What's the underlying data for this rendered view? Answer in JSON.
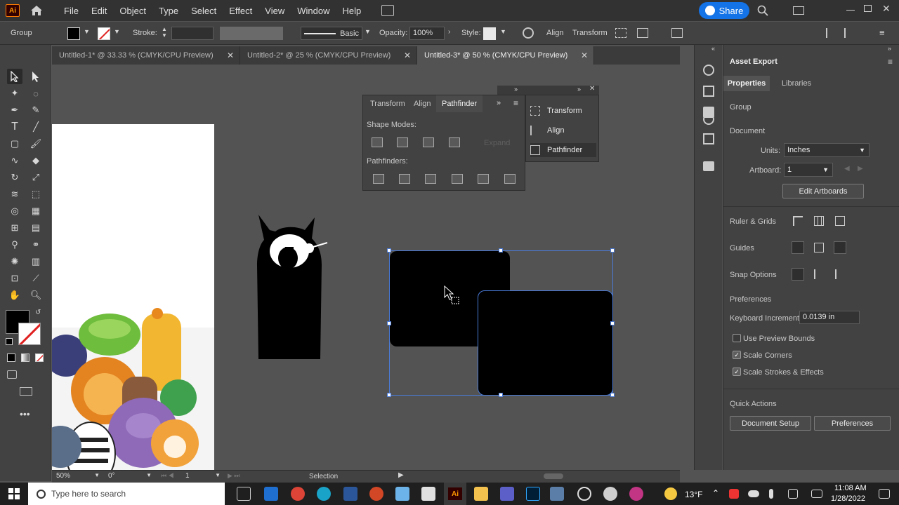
{
  "app": {
    "logo": "Ai"
  },
  "menu": [
    "File",
    "Edit",
    "Object",
    "Type",
    "Select",
    "Effect",
    "View",
    "Window",
    "Help"
  ],
  "share_label": "Share",
  "control": {
    "selection_type": "Group",
    "stroke_label": "Stroke:",
    "brush_label": "Basic",
    "opacity_label": "Opacity:",
    "opacity_value": "100%",
    "style_label": "Style:",
    "align_label": "Align",
    "transform_label": "Transform"
  },
  "tabs": [
    {
      "label": "Untitled-1* @ 33.33 % (CMYK/CPU Preview)"
    },
    {
      "label": "Untitled-2* @ 25 % (CMYK/CPU Preview)"
    },
    {
      "label": "Untitled-3* @ 50 % (CMYK/CPU Preview)"
    }
  ],
  "pathfinder_panel": {
    "tabs": [
      "Transform",
      "Align",
      "Pathfinder"
    ],
    "shape_modes_label": "Shape Modes:",
    "expand_label": "Expand",
    "pathfinders_label": "Pathfinders:"
  },
  "collapsed_panel": {
    "items": [
      "Transform",
      "Align",
      "Pathfinder"
    ]
  },
  "properties": {
    "panel_title": "Asset Export",
    "tabs": [
      "Properties",
      "Libraries"
    ],
    "selection": "Group",
    "document_label": "Document",
    "units_label": "Units:",
    "units_value": "Inches",
    "artboard_label": "Artboard:",
    "artboard_value": "1",
    "edit_artboards": "Edit Artboards",
    "ruler_grids": "Ruler & Grids",
    "guides": "Guides",
    "snap_options": "Snap Options",
    "preferences_label": "Preferences",
    "keyboard_increment_label": "Keyboard Increment:",
    "keyboard_increment_value": "0.0139 in",
    "use_preview_bounds": "Use Preview Bounds",
    "scale_corners": "Scale Corners",
    "scale_strokes": "Scale Strokes & Effects",
    "quick_actions": "Quick Actions",
    "document_setup": "Document Setup",
    "preferences_btn": "Preferences"
  },
  "status": {
    "zoom": "50%",
    "rotation": "0°",
    "artboard": "1",
    "tool": "Selection"
  },
  "taskbar": {
    "search_placeholder": "Type here to search",
    "weather": "13°F",
    "time": "11:08 AM",
    "date": "1/28/2022"
  },
  "colors": {
    "accent": "#1473e6",
    "ai_orange": "#ff9a00",
    "selection_blue": "#4a7ad6"
  }
}
